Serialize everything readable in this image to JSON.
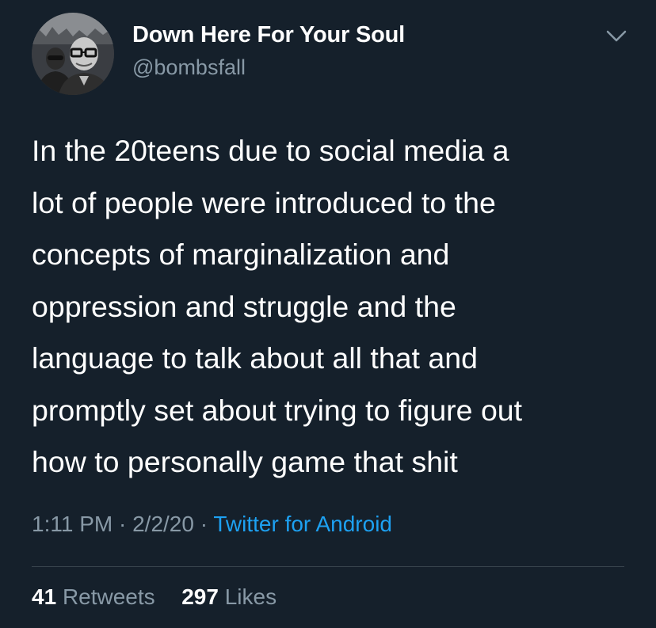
{
  "author": {
    "display_name": "Down Here For Your Soul",
    "handle": "@bombsfall"
  },
  "tweet": {
    "lines": [
      "In the 20teens due to social media a",
      "lot of people were introduced to the",
      "concepts of marginalization and",
      "oppression and struggle and the",
      "language to talk about all that and",
      "promptly set about trying to figure out",
      "how to personally game that shit"
    ],
    "time": "1:11 PM",
    "separator": "·",
    "date": "2/2/20",
    "source": "Twitter for Android"
  },
  "stats": {
    "retweets_count": "41",
    "retweets_label": "Retweets",
    "likes_count": "297",
    "likes_label": "Likes"
  },
  "icons": {
    "menu": "chevron-down-icon",
    "avatar": "avatar-photo"
  },
  "colors": {
    "background": "#15202b",
    "primary_text": "#ffffff",
    "secondary_text": "#8899a6",
    "link": "#1da1f2",
    "divider": "#38444d"
  }
}
